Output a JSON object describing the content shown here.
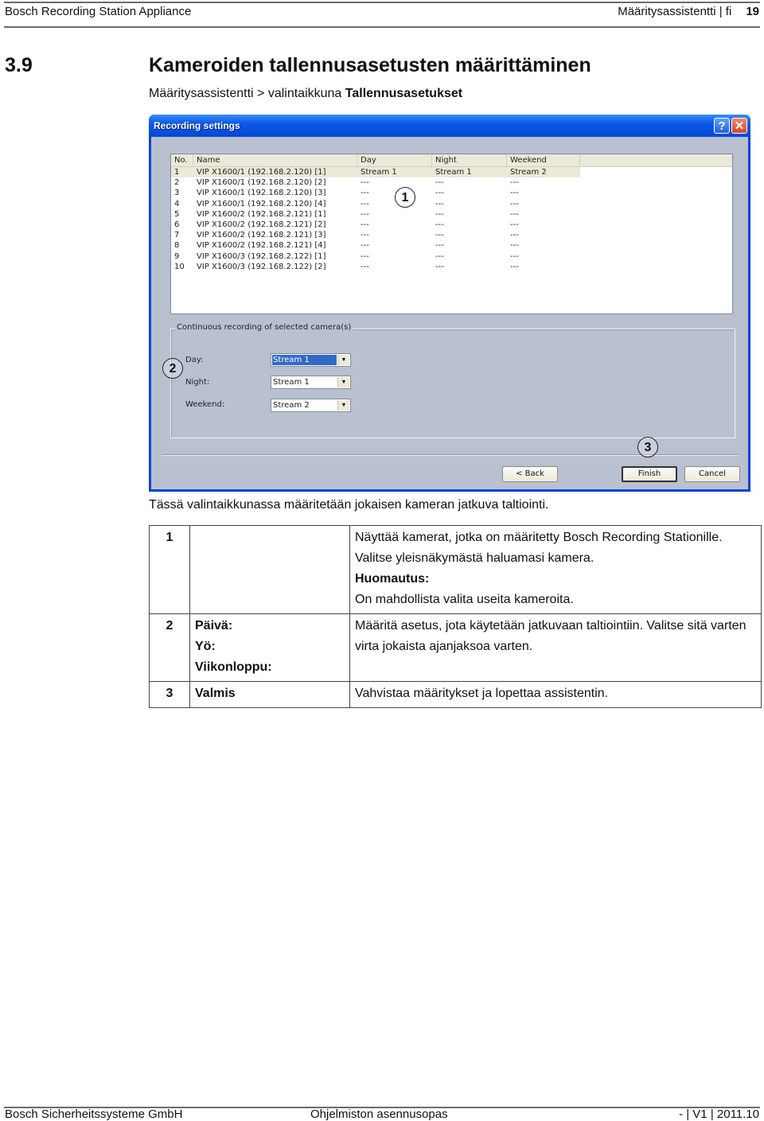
{
  "header": {
    "product": "Bosch Recording Station Appliance",
    "section_lang": "Määritysassistentti | fi",
    "page_number": "19"
  },
  "section": {
    "number": "3.9",
    "title": "Kameroiden tallennusasetusten määrittäminen",
    "breadcrumb_prefix": "Määritysassistentti > valintaikkuna ",
    "breadcrumb_bold": "Tallennusasetukset"
  },
  "dialog": {
    "title": "Recording settings",
    "help_icon": "?",
    "close_icon": "✕",
    "columns": [
      "No.",
      "Name",
      "Day",
      "Night",
      "Weekend"
    ],
    "rows": [
      {
        "no": "1",
        "name": "VIP X1600/1 (192.168.2.120) [1]",
        "day": "Stream 1",
        "night": "Stream 1",
        "weekend": "Stream 2",
        "selected": true
      },
      {
        "no": "2",
        "name": "VIP X1600/1 (192.168.2.120) [2]",
        "day": "---",
        "night": "---",
        "weekend": "---"
      },
      {
        "no": "3",
        "name": "VIP X1600/1 (192.168.2.120) [3]",
        "day": "---",
        "night": "---",
        "weekend": "---"
      },
      {
        "no": "4",
        "name": "VIP X1600/1 (192.168.2.120) [4]",
        "day": "---",
        "night": "---",
        "weekend": "---"
      },
      {
        "no": "5",
        "name": "VIP X1600/2 (192.168.2.121) [1]",
        "day": "---",
        "night": "---",
        "weekend": "---"
      },
      {
        "no": "6",
        "name": "VIP X1600/2 (192.168.2.121) [2]",
        "day": "---",
        "night": "---",
        "weekend": "---"
      },
      {
        "no": "7",
        "name": "VIP X1600/2 (192.168.2.121) [3]",
        "day": "---",
        "night": "---",
        "weekend": "---"
      },
      {
        "no": "8",
        "name": "VIP X1600/2 (192.168.2.121) [4]",
        "day": "---",
        "night": "---",
        "weekend": "---"
      },
      {
        "no": "9",
        "name": "VIP X1600/3 (192.168.2.122) [1]",
        "day": "---",
        "night": "---",
        "weekend": "---"
      },
      {
        "no": "10",
        "name": "VIP X1600/3 (192.168.2.122) [2]",
        "day": "---",
        "night": "---",
        "weekend": "---"
      }
    ],
    "group_label": "Continuous recording of selected camera(s)",
    "fields": {
      "day_label": "Day:",
      "day_value": "Stream 1",
      "night_label": "Night:",
      "night_value": "Stream 1",
      "weekend_label": "Weekend:",
      "weekend_value": "Stream 2"
    },
    "buttons": {
      "back": "< Back",
      "finish": "Finish",
      "cancel": "Cancel"
    },
    "callouts": [
      "1",
      "2",
      "3"
    ],
    "colors": {
      "titlebar": "#0a5ae6",
      "client": "#b9c1d1",
      "selection": "#3169c6"
    }
  },
  "caption": "Tässä valintaikkunassa määritetään jokaisen kameran jatkuva taltiointi.",
  "legend": [
    {
      "num": "1",
      "terms": [],
      "desc_lines": [
        {
          "text": "Näyttää kamerat, jotka on määritetty Bosch Recording Stationille.",
          "bold": false
        },
        {
          "text": "Valitse yleisnäkymästä haluamasi kamera.",
          "bold": false
        },
        {
          "text": "Huomautus:",
          "bold": true
        },
        {
          "text": "On mahdollista valita useita kameroita.",
          "bold": false
        }
      ]
    },
    {
      "num": "2",
      "terms": [
        "Päivä:",
        "Yö:",
        "Viikonloppu:"
      ],
      "desc_lines": [
        {
          "text": "Määritä asetus, jota käytetään jatkuvaan taltiointiin. Valitse sitä varten virta jokaista ajanjaksoa varten.",
          "bold": false
        }
      ]
    },
    {
      "num": "3",
      "terms": [
        "Valmis"
      ],
      "desc_lines": [
        {
          "text": "Vahvistaa määritykset ja lopettaa assistentin.",
          "bold": false
        }
      ]
    }
  ],
  "footer": {
    "company": "Bosch Sicherheitssysteme GmbH",
    "document": "Ohjelmiston asennusopas",
    "version": "- | V1 | 2011.10"
  }
}
